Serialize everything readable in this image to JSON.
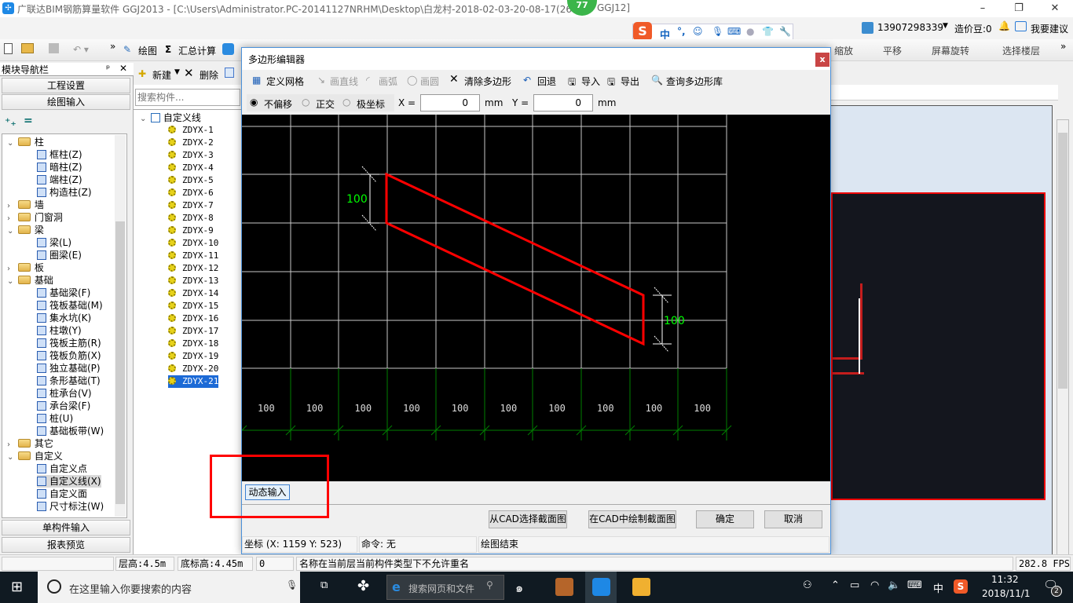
{
  "window": {
    "title": "广联达BIM钢筋算量软件 GGJ2013 - [C:\\Users\\Administrator.PC-20141127NRHM\\Desktop\\白龙村-2018-02-03-20-08-17(26",
    "title_suffix": "GGJ12]",
    "badge": "77",
    "minimize": "–",
    "maximize": "❐",
    "close": "✕"
  },
  "ime": {
    "brand": "S",
    "lang": "中",
    "punct": "°,"
  },
  "user": {
    "phone": "13907298339",
    "beans": "造价豆:0",
    "feedback": "我要建议"
  },
  "toolbar": {
    "more": "»",
    "draw": "绘图",
    "sum_calc": "汇总计算",
    "zoom": "缩放",
    "pan": "平移",
    "rotate": "屏幕旋转",
    "select_floor": "选择楼层",
    "more_right": "»"
  },
  "nav": {
    "title": "模块导航栏",
    "pin": "ᵖ",
    "close": "✕",
    "project_settings": "工程设置",
    "drawing_input": "绘图输入",
    "single_input": "单构件输入",
    "report_preview": "报表预览",
    "tree": [
      {
        "label": "柱",
        "level": 0,
        "type": "folder",
        "open": true
      },
      {
        "label": "框柱(Z)",
        "level": 1
      },
      {
        "label": "暗柱(Z)",
        "level": 1
      },
      {
        "label": "端柱(Z)",
        "level": 1
      },
      {
        "label": "构造柱(Z)",
        "level": 1
      },
      {
        "label": "墙",
        "level": 0,
        "type": "folder",
        "open": false
      },
      {
        "label": "门窗洞",
        "level": 0,
        "type": "folder",
        "open": false
      },
      {
        "label": "梁",
        "level": 0,
        "type": "folder",
        "open": true
      },
      {
        "label": "梁(L)",
        "level": 1
      },
      {
        "label": "圈梁(E)",
        "level": 1
      },
      {
        "label": "板",
        "level": 0,
        "type": "folder",
        "open": false
      },
      {
        "label": "基础",
        "level": 0,
        "type": "folder",
        "open": true
      },
      {
        "label": "基础梁(F)",
        "level": 1
      },
      {
        "label": "筏板基础(M)",
        "level": 1
      },
      {
        "label": "集水坑(K)",
        "level": 1
      },
      {
        "label": "柱墩(Y)",
        "level": 1
      },
      {
        "label": "筏板主筋(R)",
        "level": 1
      },
      {
        "label": "筏板负筋(X)",
        "level": 1
      },
      {
        "label": "独立基础(P)",
        "level": 1
      },
      {
        "label": "条形基础(T)",
        "level": 1
      },
      {
        "label": "桩承台(V)",
        "level": 1
      },
      {
        "label": "承台梁(F)",
        "level": 1
      },
      {
        "label": "桩(U)",
        "level": 1
      },
      {
        "label": "基础板带(W)",
        "level": 1
      },
      {
        "label": "其它",
        "level": 0,
        "type": "folder",
        "open": false
      },
      {
        "label": "自定义",
        "level": 0,
        "type": "folder",
        "open": true
      },
      {
        "label": "自定义点",
        "level": 1
      },
      {
        "label": "自定义线(X)",
        "level": 1,
        "selected": true
      },
      {
        "label": "自定义面",
        "level": 1
      },
      {
        "label": "尺寸标注(W)",
        "level": 1
      }
    ]
  },
  "components": {
    "new": "新建",
    "delete": "删除",
    "search_placeholder": "搜索构件...",
    "root": "自定义线",
    "items": [
      "ZDYX-1",
      "ZDYX-2",
      "ZDYX-3",
      "ZDYX-4",
      "ZDYX-5",
      "ZDYX-6",
      "ZDYX-7",
      "ZDYX-8",
      "ZDYX-9",
      "ZDYX-10",
      "ZDYX-11",
      "ZDYX-12",
      "ZDYX-13",
      "ZDYX-14",
      "ZDYX-15",
      "ZDYX-16",
      "ZDYX-17",
      "ZDYX-18",
      "ZDYX-19",
      "ZDYX-20",
      "ZDYX-21"
    ],
    "selected": "ZDYX-21"
  },
  "dialog": {
    "title": "多边形编辑器",
    "close": "x",
    "tools": {
      "define_grid": "定义网格",
      "line": "画直线",
      "arc": "画弧",
      "circle": "画圆",
      "clear": "清除多边形",
      "undo": "回退",
      "import": "导入",
      "export": "导出",
      "query_lib": "查询多边形库"
    },
    "snap": {
      "options": [
        "不偏移",
        "正交",
        "极坐标"
      ],
      "selected": "不偏移",
      "x_label": "X =",
      "x_value": "0",
      "x_unit": "mm",
      "y_label": "Y =",
      "y_value": "0",
      "y_unit": "mm"
    },
    "canvas": {
      "polygon_color": "#ff0000",
      "grid_color": "#c8c8c8",
      "axis_color": "#008000",
      "left_dim": "100",
      "right_dim": "100",
      "column_labels": [
        "100",
        "100",
        "100",
        "100",
        "100",
        "100",
        "100",
        "100",
        "100",
        "100"
      ]
    },
    "dynamic_input": "动态输入",
    "buttons": {
      "select_from_cad": "从CAD选择截面图",
      "draw_in_cad": "在CAD中绘制截面图",
      "ok": "确定",
      "cancel": "取消"
    },
    "status": {
      "coords": "坐标 (X: 1159 Y: 523)",
      "command": "命令: 无",
      "message": "绘图结束"
    }
  },
  "statusbar": {
    "floor_height": "层高:4.5m",
    "base_height": "底标高:4.45m",
    "value": "0",
    "message": "名称在当前层当前构件类型下不允许重名",
    "fps": "282.8 FPS"
  },
  "taskbar": {
    "search_placeholder": "在这里输入你要搜索的内容",
    "browser_search": "搜索网页和文件",
    "lang": "中",
    "time": "11:32",
    "date": "2018/11/1",
    "notifications": "2"
  }
}
